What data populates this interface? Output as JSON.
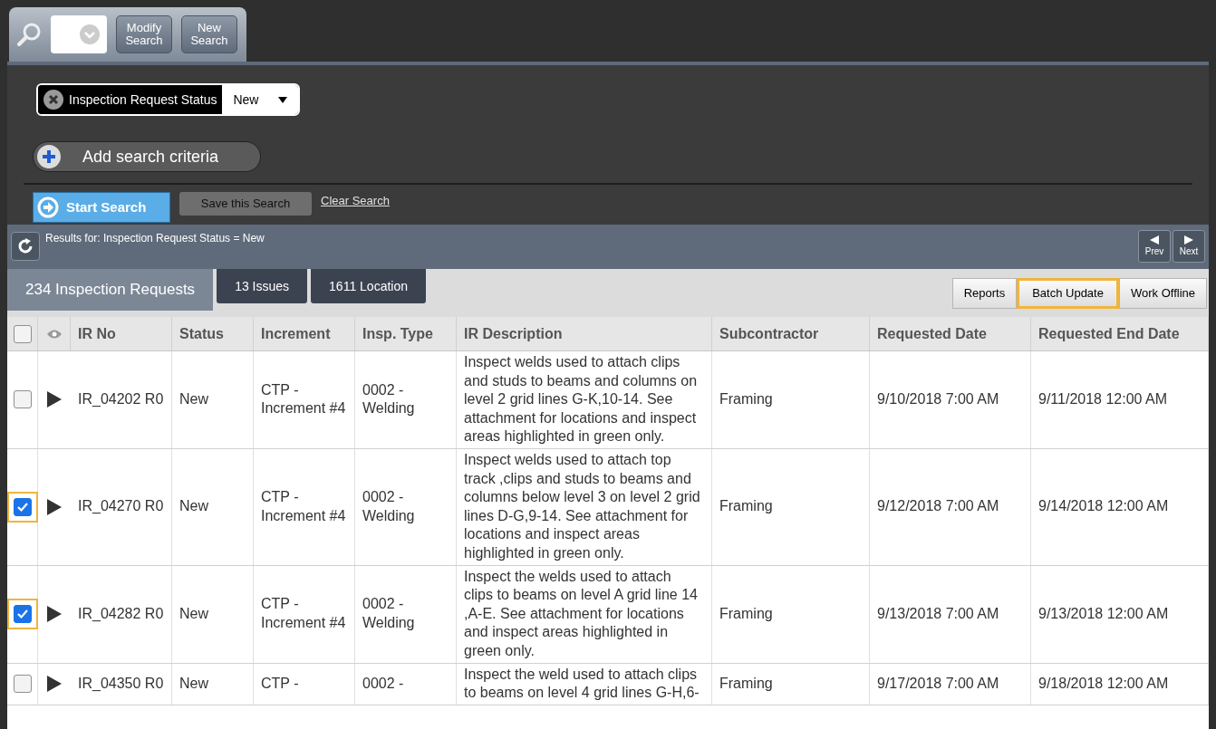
{
  "search_tab": {
    "buttons": [
      "Modify Search",
      "New Search"
    ]
  },
  "criteria": [
    {
      "label": "Inspection Request Status",
      "value": "New"
    }
  ],
  "add_criteria": "Add search criteria",
  "actions": {
    "start": "Start Search",
    "save": "Save this Search",
    "clear": "Clear Search"
  },
  "results": {
    "title": "Results for: Inspection Request Status = New",
    "prev": "Prev",
    "next": "Next"
  },
  "tabs": [
    {
      "label": "234 Inspection Requests",
      "selected": true
    },
    {
      "label": "13 Issues",
      "selected": false
    },
    {
      "label": "1611 Location",
      "selected": false
    }
  ],
  "toolbar": [
    {
      "label": "Reports",
      "highlighted": false
    },
    {
      "label": "Batch Update",
      "highlighted": true
    },
    {
      "label": "Work Offline",
      "highlighted": false
    }
  ],
  "table": {
    "select_all_checked": false,
    "columns": [
      "IR No",
      "Status",
      "Increment",
      "Insp. Type",
      "IR Description",
      "Subcontractor",
      "Requested Date",
      "Requested End Date"
    ],
    "rows": [
      {
        "checked": false,
        "cells": [
          "IR_04202 R0",
          "New",
          "CTP - Increment #4",
          "0002 - Welding",
          "Inspect welds used to attach clips and studs to beams and columns on level 2 grid lines G-K,10-14. See attachment for locations and inspect areas highlighted in green only.",
          "Framing",
          "9/10/2018 7:00 AM",
          "9/11/2018 12:00 AM"
        ]
      },
      {
        "checked": true,
        "cells": [
          "IR_04270 R0",
          "New",
          "CTP - Increment #4",
          "0002 - Welding",
          "Inspect welds used to attach top track ,clips and studs to beams and columns below level 3 on level 2 grid lines D-G,9-14. See attachment for locations and inspect areas highlighted in green only.",
          "Framing",
          "9/12/2018 7:00 AM",
          "9/14/2018 12:00 AM"
        ]
      },
      {
        "checked": true,
        "cells": [
          "IR_04282 R0",
          "New",
          "CTP - Increment #4",
          "0002 - Welding",
          "Inspect the welds used to attach clips to beams on level A grid line 14 ,A-E. See attachment for locations and inspect areas highlighted in green only.",
          "Framing",
          "9/13/2018 7:00 AM",
          "9/13/2018 12:00 AM"
        ]
      },
      {
        "checked": false,
        "cells": [
          "IR_04350 R0",
          "New",
          "CTP -",
          "0002 -",
          "Inspect the weld used to attach clips to beams on level 4 grid lines G-H,6-",
          "Framing",
          "9/17/2018 7:00 AM",
          "9/18/2018 12:00 AM"
        ]
      }
    ]
  }
}
